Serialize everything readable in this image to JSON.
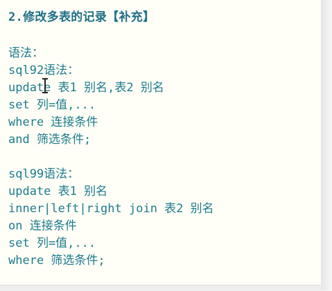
{
  "heading": "2.修改多表的记录【补充】",
  "lines": [
    "语法：",
    "sql92语法：",
    "update 表1 别名,表2 别名",
    "set 列=值,...",
    "where 连接条件",
    "and 筛选条件;",
    "",
    "sql99语法：",
    "update 表1 别名",
    "inner|left|right join 表2 别名",
    "on 连接条件",
    "set 列=值,...",
    "where 筛选条件;"
  ]
}
